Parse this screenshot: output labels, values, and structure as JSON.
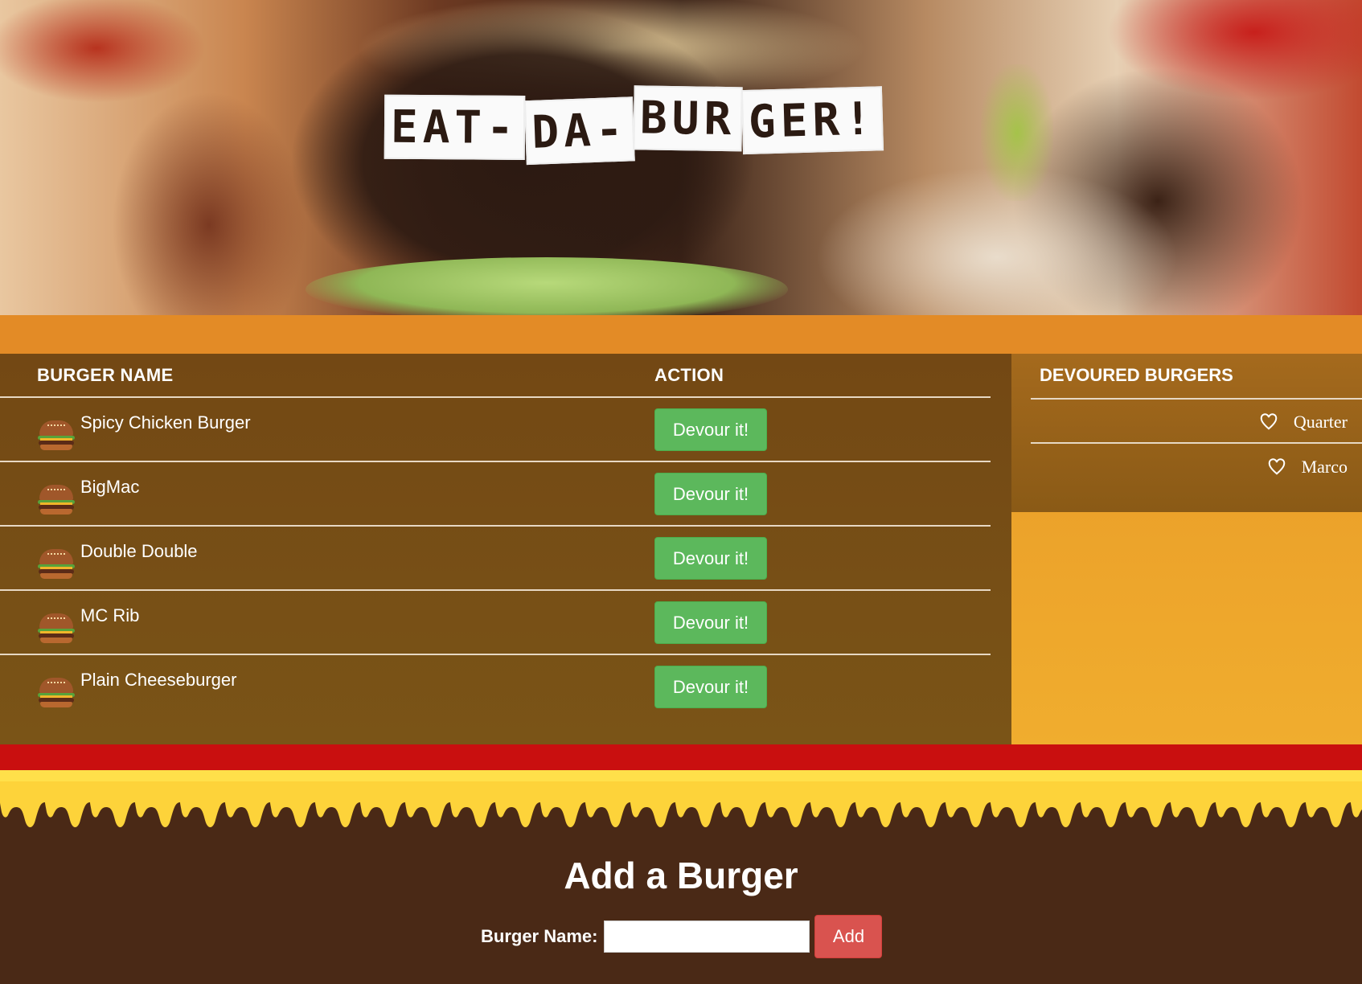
{
  "header": {
    "logo_text_parts": [
      "EAT-",
      "DA-",
      "BUR",
      "GER!"
    ]
  },
  "table": {
    "col_name": "BURGER NAME",
    "col_action": "ACTION",
    "rows": [
      {
        "name": "Spicy Chicken Burger",
        "action": "Devour it!"
      },
      {
        "name": "BigMac",
        "action": "Devour it!"
      },
      {
        "name": "Double Double",
        "action": "Devour it!"
      },
      {
        "name": "MC Rib",
        "action": "Devour it!"
      },
      {
        "name": "Plain Cheeseburger",
        "action": "Devour it!"
      }
    ]
  },
  "devoured": {
    "title": "DEVOURED BURGERS",
    "items": [
      {
        "name": "Quarter",
        "icon": "heart-icon"
      },
      {
        "name": "Marco",
        "icon": "heart-icon"
      }
    ]
  },
  "add_form": {
    "title": "Add a Burger",
    "label": "Burger Name:",
    "input_value": "",
    "button": "Add"
  },
  "colors": {
    "orange": "#e38b26",
    "ketchup": "#c90f0f",
    "mustard": "#fdd33a",
    "brown": "#4a2916",
    "devour_green": "#5cb85c",
    "add_red": "#d9534f"
  }
}
